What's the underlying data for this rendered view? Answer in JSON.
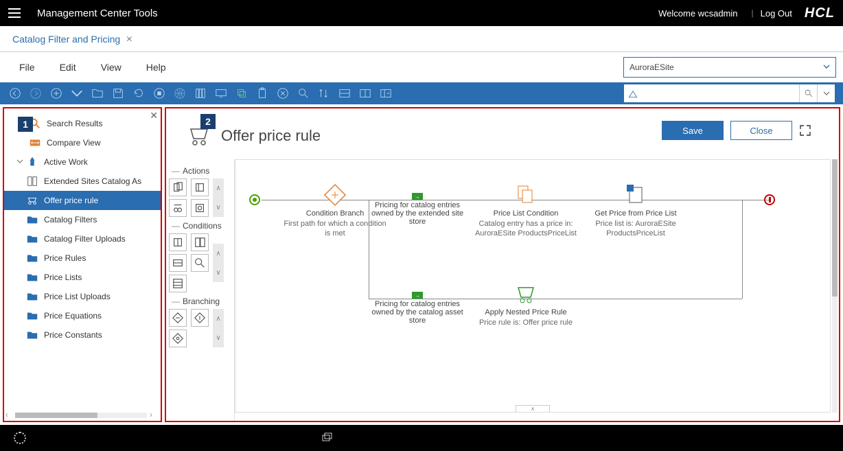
{
  "topbar": {
    "title": "Management Center Tools",
    "welcome": "Welcome wcsadmin",
    "logout": "Log Out",
    "logo": "HCL"
  },
  "tab": {
    "label": "Catalog Filter and Pricing"
  },
  "menu": {
    "file": "File",
    "edit": "Edit",
    "view": "View",
    "help": "Help"
  },
  "store": {
    "selected": "AuroraESite"
  },
  "sidebar": {
    "badge": "1",
    "items": {
      "search": "Search Results",
      "compare": "Compare View",
      "active": "Active Work",
      "extended": "Extended Sites Catalog As",
      "offer": "Offer price rule",
      "filters": "Catalog Filters",
      "uploads": "Catalog Filter Uploads",
      "rules": "Price Rules",
      "lists": "Price Lists",
      "listuploads": "Price List Uploads",
      "equations": "Price Equations",
      "constants": "Price Constants"
    }
  },
  "editor": {
    "badge": "2",
    "title": "Offer price rule",
    "save": "Save",
    "close": "Close",
    "palette": {
      "actions": "Actions",
      "conditions": "Conditions",
      "branching": "Branching"
    },
    "nodes": {
      "cond": {
        "title": "Condition Branch",
        "desc": "First path for which a condition is met"
      },
      "p1": {
        "title": "Pricing for catalog entries owned by the extended site store"
      },
      "plc": {
        "title": "Price List Condition",
        "desc": "Catalog entry has a price in: AuroraESite ProductsPriceList"
      },
      "get": {
        "title": "Get Price from Price List",
        "desc": "Price list is: AuroraESite ProductsPriceList"
      },
      "p2": {
        "title": "Pricing for catalog entries owned by the catalog asset store"
      },
      "nest": {
        "title": "Apply Nested Price Rule",
        "desc": "Price rule is: Offer price rule"
      }
    }
  }
}
